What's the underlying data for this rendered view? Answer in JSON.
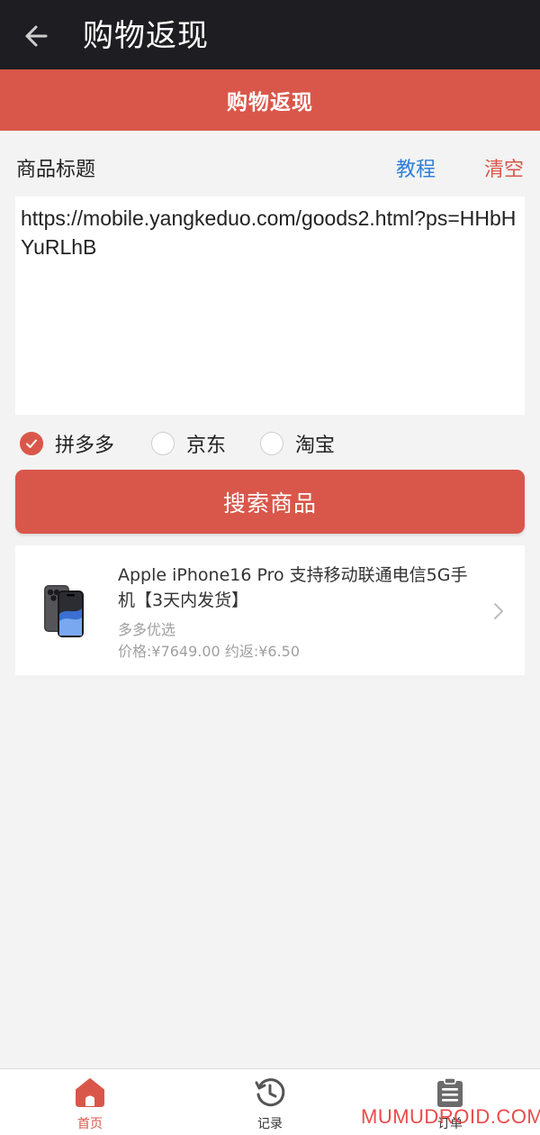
{
  "header": {
    "title": "购物返现",
    "back_icon": "arrow-left-icon"
  },
  "banner": {
    "title": "购物返现"
  },
  "form": {
    "label": "商品标题",
    "tutorial_link": "教程",
    "clear_link": "清空",
    "url_value": "https://mobile.yangkeduo.com/goods2.html?ps=HHbHYuRLhB"
  },
  "platforms": [
    {
      "label": "拼多多",
      "checked": true
    },
    {
      "label": "京东",
      "checked": false
    },
    {
      "label": "淘宝",
      "checked": false
    }
  ],
  "search_button": {
    "label": "搜索商品"
  },
  "product": {
    "title": "Apple iPhone16 Pro 支持移动联通电信5G手机【3天内发货】",
    "shop": "多多优选",
    "price_line": "价格:¥7649.00 约返:¥6.50",
    "image": "iphone-product-image",
    "arrow_icon": "chevron-right-icon"
  },
  "bottom_nav": [
    {
      "label": "首页",
      "icon": "home-icon",
      "active": true
    },
    {
      "label": "记录",
      "icon": "history-icon",
      "active": false
    },
    {
      "label": "订单",
      "icon": "clipboard-icon",
      "active": false
    }
  ],
  "watermark": "MUMUDROID.COM",
  "colors": {
    "accent": "#d9574a",
    "header_bg": "#1e1e22",
    "link_blue": "#2f7fd8",
    "page_bg": "#f3f3f3",
    "watermark_red": "#ea3b3b"
  }
}
